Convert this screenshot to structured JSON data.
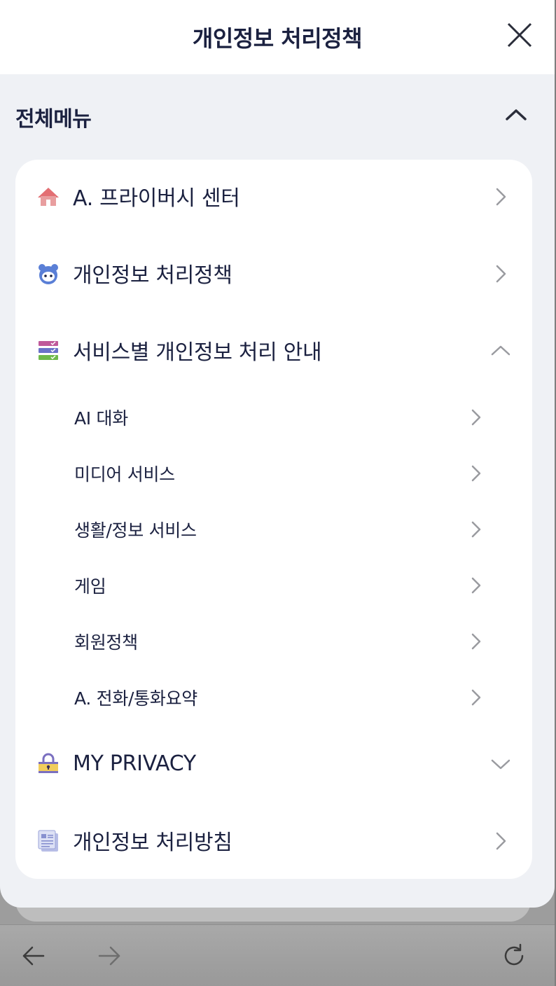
{
  "header": {
    "title": "개인정보 처리정책"
  },
  "section": {
    "title": "전체메뉴"
  },
  "menu": {
    "items": [
      {
        "label": "A. 프라이버시 센터",
        "icon": "home-icon"
      },
      {
        "label": "개인정보 처리정책",
        "icon": "character-face-icon"
      },
      {
        "label": "서비스별 개인정보 처리 안내",
        "icon": "service-list-icon"
      },
      {
        "label": "MY PRIVACY",
        "icon": "lock-icon"
      },
      {
        "label": "개인정보 처리방침",
        "icon": "document-icon"
      }
    ],
    "subitems": [
      {
        "label": "AI 대화"
      },
      {
        "label": "미디어 서비스"
      },
      {
        "label": "생활/정보 서비스"
      },
      {
        "label": "게임"
      },
      {
        "label": "회원정책"
      },
      {
        "label": "A. 전화/통화요약"
      }
    ]
  },
  "colors": {
    "sheet_bg": "#eff1f5",
    "text": "#1b2140",
    "chevron": "#9a9ba0"
  }
}
